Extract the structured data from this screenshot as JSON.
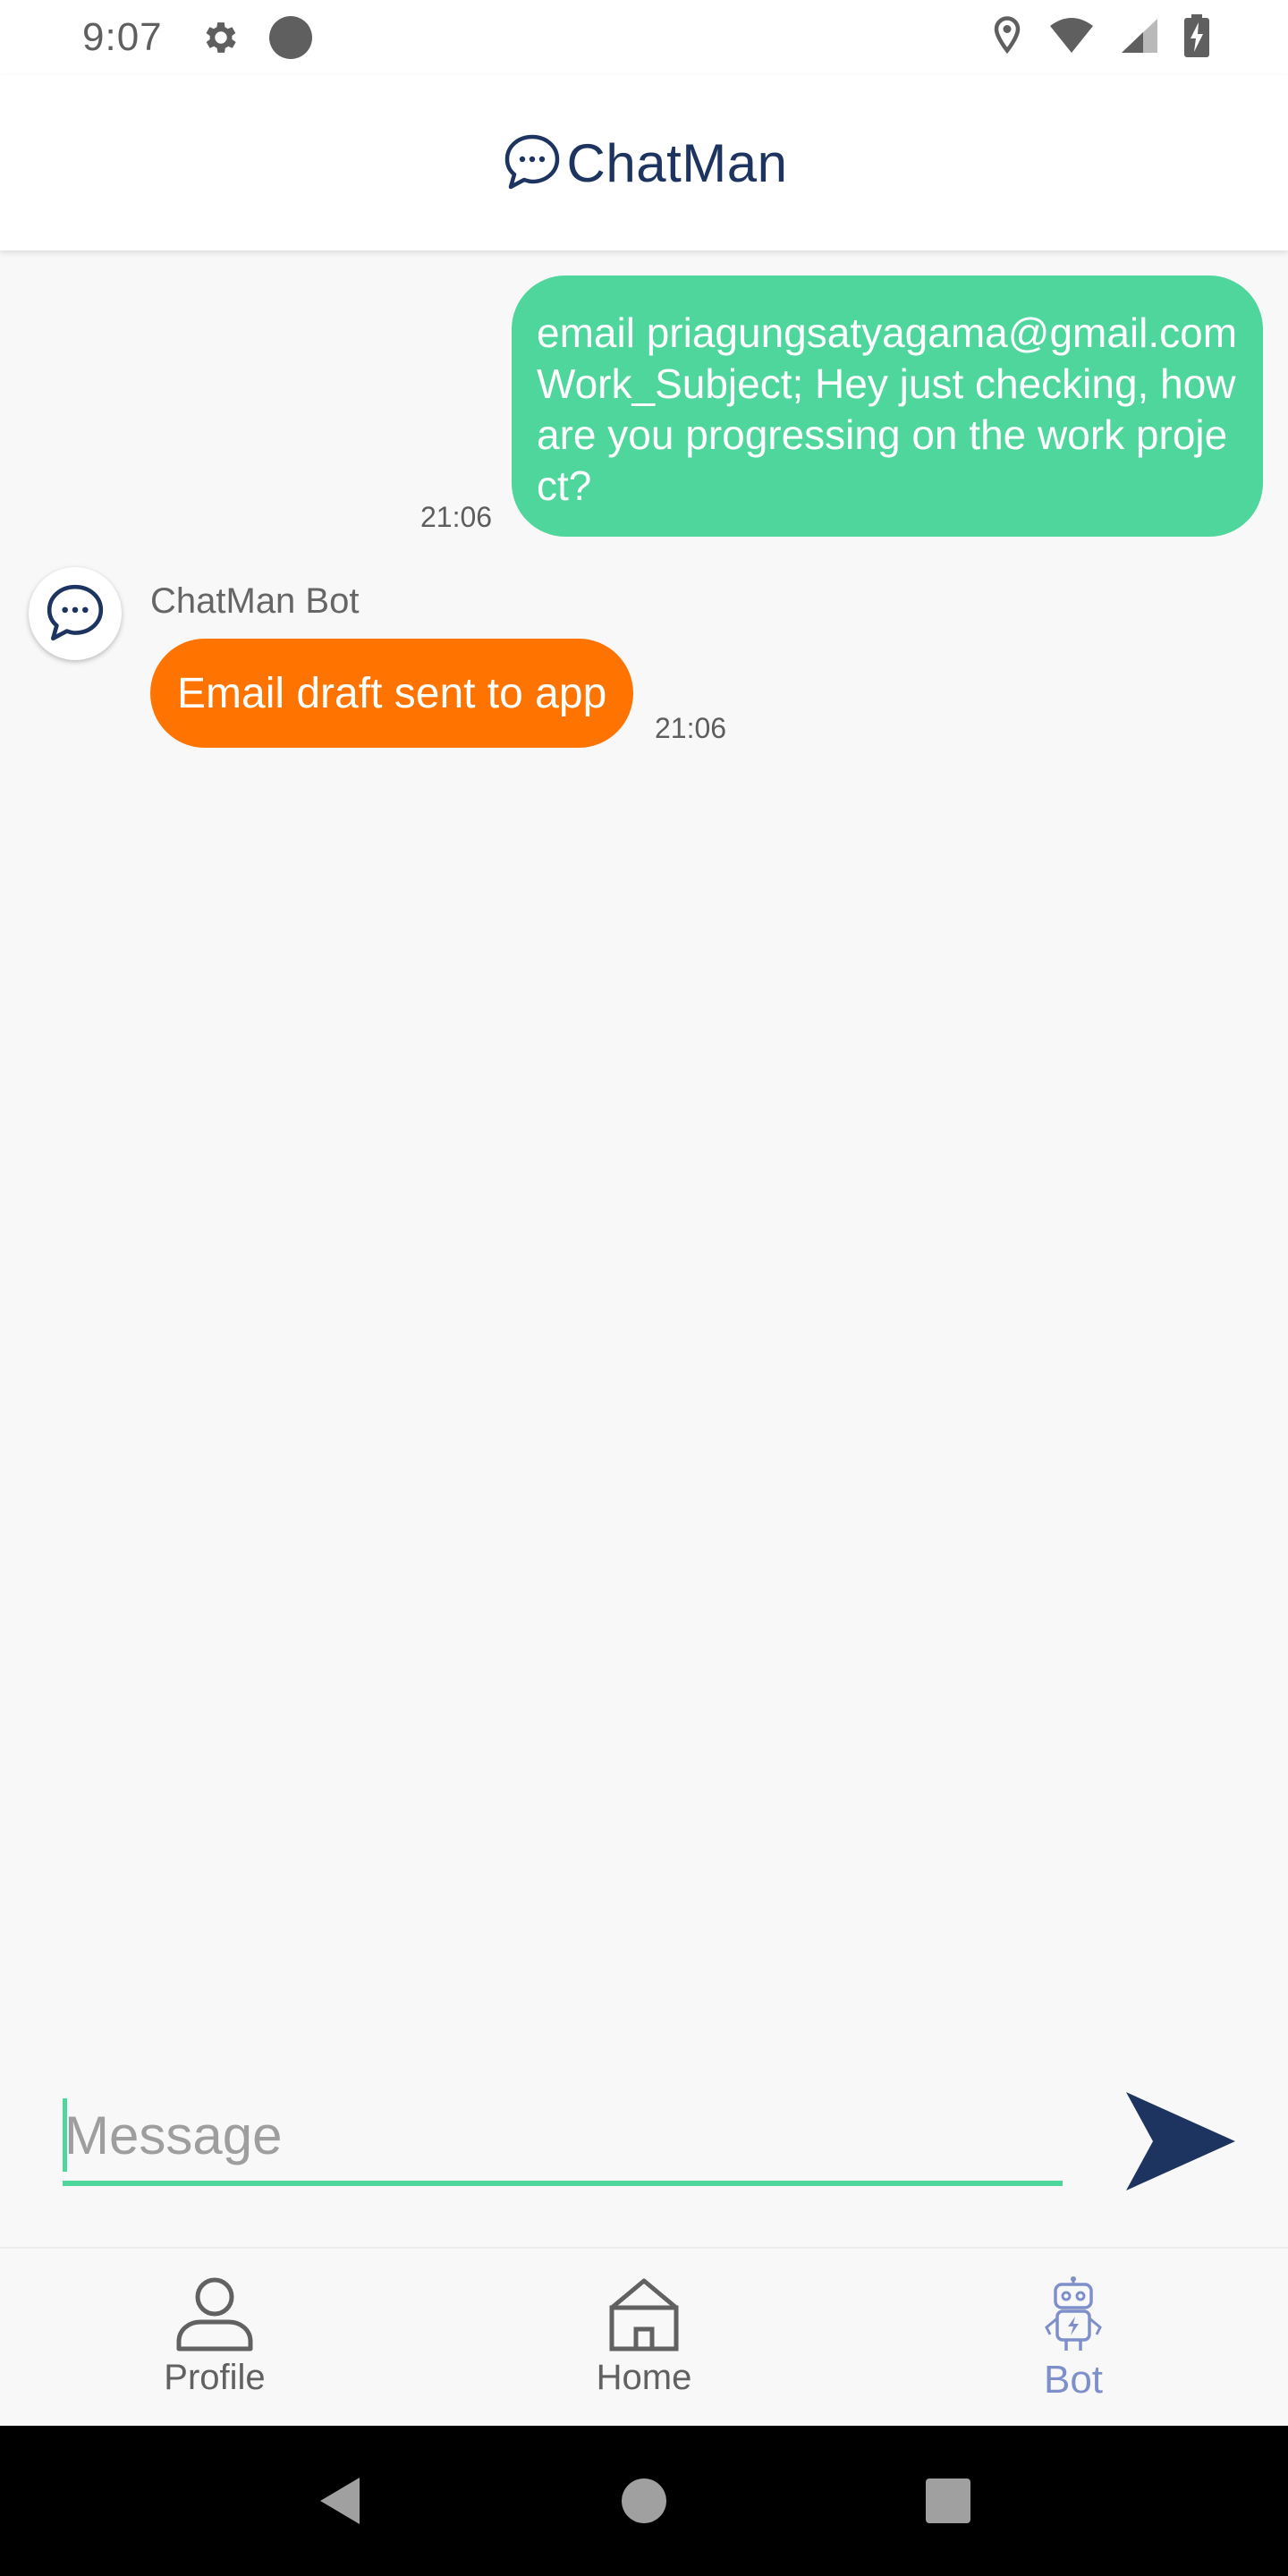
{
  "status_bar": {
    "time": "9:07"
  },
  "header": {
    "title": "ChatMan"
  },
  "chat": {
    "messages": [
      {
        "sender": "user",
        "text": "email priagungsatyagama@gmail.com Work_Subject; Hey just checking, how are you progressing on the work project?",
        "time": "21:06"
      },
      {
        "sender": "bot",
        "name": "ChatMan Bot",
        "text": "Email draft sent to app",
        "time": "21:06"
      }
    ]
  },
  "composer": {
    "placeholder": "Message"
  },
  "bottom_nav": {
    "items": [
      {
        "label": "Profile",
        "icon": "person-icon",
        "active": false
      },
      {
        "label": "Home",
        "icon": "home-icon",
        "active": false
      },
      {
        "label": "Bot",
        "icon": "robot-icon",
        "active": true
      }
    ]
  },
  "colors": {
    "user_bubble": "#4fd69c",
    "bot_bubble": "#ff7300",
    "brand": "#1d3461",
    "active_nav": "#7f8fc9"
  }
}
